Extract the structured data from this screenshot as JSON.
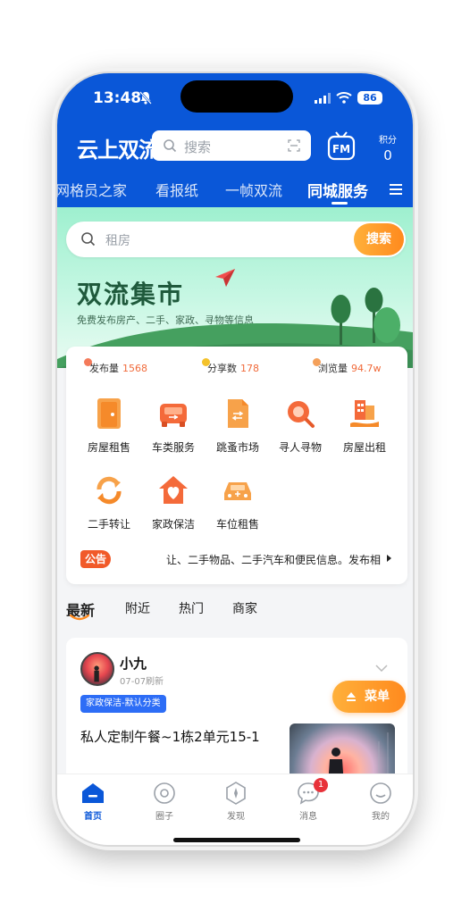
{
  "status_bar": {
    "time": "13:48",
    "battery": "86"
  },
  "header": {
    "logo": "云上双流",
    "search_placeholder": "搜索",
    "points_label": "积分",
    "points_value": "0",
    "tabs": [
      {
        "label": "网格员之家"
      },
      {
        "label": "看报纸"
      },
      {
        "label": "一帧双流"
      },
      {
        "label": "同城服务"
      }
    ]
  },
  "hero": {
    "search_placeholder": "租房",
    "search_button": "搜索",
    "title": "双流集市",
    "subtitle": "免费发布房产、二手、家政、寻物等信息"
  },
  "stats": [
    {
      "label": "发布量",
      "value": "1568",
      "dot_color": "#f47a5a"
    },
    {
      "label": "分享数",
      "value": "178",
      "dot_color": "#f4c22b"
    },
    {
      "label": "浏览量",
      "value": "94.7w",
      "dot_color": "#f4a05a"
    }
  ],
  "categories": [
    {
      "label": "房屋租售",
      "icon": "door-icon"
    },
    {
      "label": "车类服务",
      "icon": "car-icon"
    },
    {
      "label": "跳蚤市场",
      "icon": "document-icon"
    },
    {
      "label": "寻人寻物",
      "icon": "magnifier-icon"
    },
    {
      "label": "房屋出租",
      "icon": "building-icon"
    },
    {
      "label": "二手转让",
      "icon": "exchange-icon"
    },
    {
      "label": "家政保洁",
      "icon": "heart-house-icon"
    },
    {
      "label": "车位租售",
      "icon": "parking-car-icon"
    }
  ],
  "notice": {
    "tag": "公告",
    "text": "让、二手物品、二手汽车和便民信息。发布相"
  },
  "feed_tabs": [
    {
      "label": "最新"
    },
    {
      "label": "附近"
    },
    {
      "label": "热门"
    },
    {
      "label": "商家"
    }
  ],
  "post": {
    "user": "小九",
    "time": "07-07刷新",
    "tag": "家政保洁-默认分类",
    "title": "私人定制午餐~1栋2单元15-1"
  },
  "fab_label": "菜单",
  "bottom_nav": [
    {
      "label": "首页",
      "icon": "home-icon"
    },
    {
      "label": "圈子",
      "icon": "circle-icon"
    },
    {
      "label": "发现",
      "icon": "compass-icon"
    },
    {
      "label": "消息",
      "icon": "chat-icon",
      "badge": "1"
    },
    {
      "label": "我的",
      "icon": "profile-icon"
    }
  ],
  "colors": {
    "brand_blue": "#0a57d8",
    "accent_orange": "#ff8a1e"
  }
}
